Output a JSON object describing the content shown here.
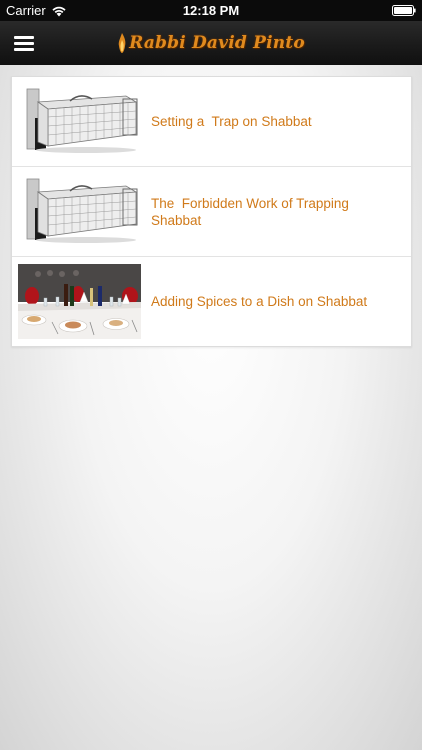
{
  "status_bar": {
    "carrier": "Carrier",
    "time": "12:18 PM",
    "wifi_icon": "wifi-icon",
    "battery_icon": "battery-icon"
  },
  "nav_bar": {
    "brand_title": "Rabbi David Pinto",
    "brand_icon": "flame-icon",
    "menu_icon": "hamburger-menu-icon",
    "brand_color": "#e08a1e",
    "bar_color": "#1c1c1c"
  },
  "articles": [
    {
      "title": "Setting a  Trap on Shabbat",
      "thumbnail": "animal-trap-cage"
    },
    {
      "title": "The  Forbidden Work of Trapping\nShabbat",
      "thumbnail": "animal-trap-cage"
    },
    {
      "title": "Adding Spices to a Dish on Shabbat",
      "thumbnail": "set-dinner-table"
    }
  ],
  "colors": {
    "title_text": "#d07a1a",
    "background": "#f4f4f4"
  }
}
